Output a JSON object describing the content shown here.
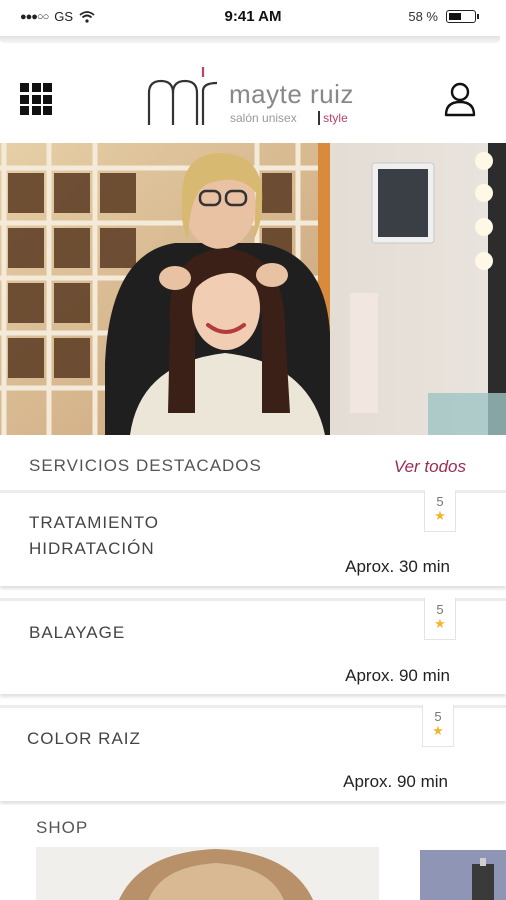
{
  "status_bar": {
    "carrier": "GS",
    "signal_dots": "●●●○○",
    "time": "9:41 AM",
    "battery_percent": "58 %",
    "battery_level": 0.58
  },
  "header": {
    "menu_icon": "grid-menu-icon",
    "logo_mark": "mr",
    "logo_name": "mayte ruiz",
    "logo_tagline": "salón unisex",
    "logo_style": "style",
    "user_icon": "user-icon"
  },
  "hero": {
    "description_icon": "hero-photo"
  },
  "featured": {
    "title": "SERVICIOS DESTACADOS",
    "see_all": "Ver todos"
  },
  "services": [
    {
      "name_line1": "TRATAMIENTO",
      "name_line2": "HIDRATACIÓN",
      "duration": "Aprox. 30 min",
      "rating": "5"
    },
    {
      "name_line1": "BALAYAGE",
      "name_line2": "",
      "duration": "Aprox. 90 min",
      "rating": "5"
    },
    {
      "name_line1": "COLOR RAIZ",
      "name_line2": "",
      "duration": "Aprox. 90 min",
      "rating": "5"
    }
  ],
  "shop": {
    "title": "SHOP"
  },
  "colors": {
    "accent": "#9c2c55",
    "star": "#f3b52b",
    "text": "#444444"
  }
}
